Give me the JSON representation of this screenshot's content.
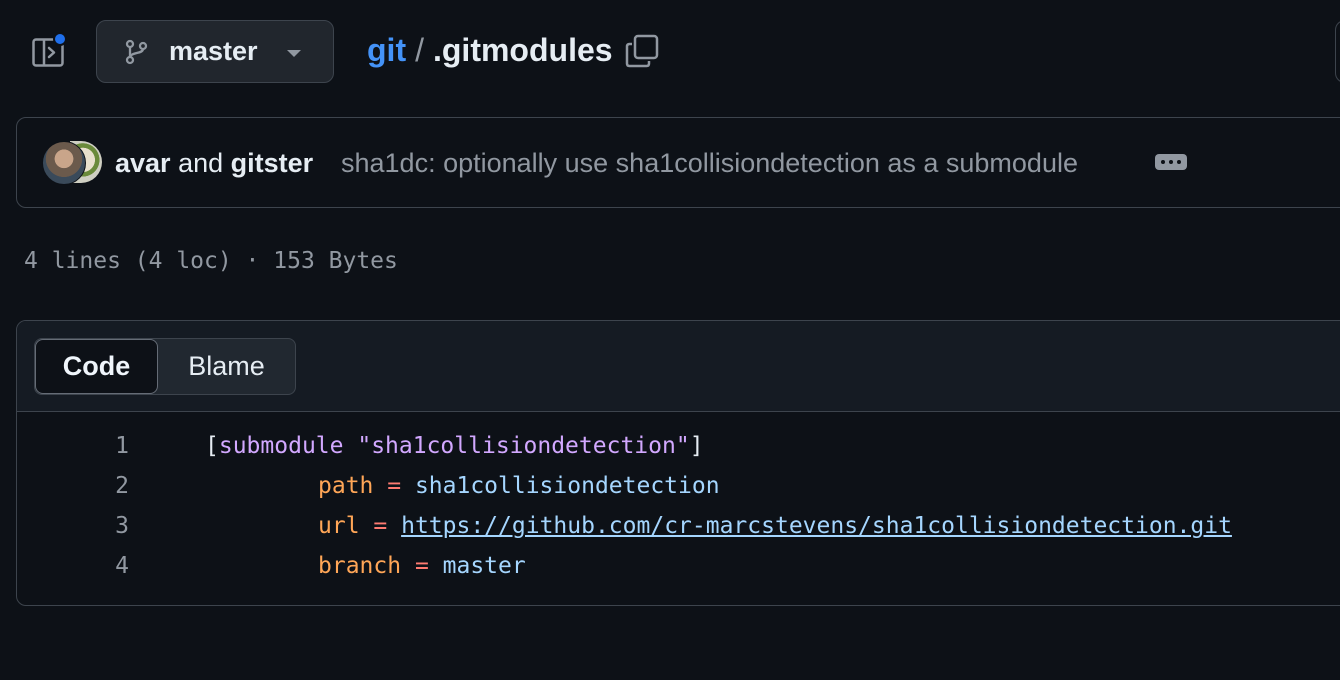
{
  "header": {
    "branch": "master",
    "repo": "git",
    "separator": "/",
    "file": ".gitmodules"
  },
  "commit": {
    "author1": "avar",
    "and": "and",
    "author2": "gitster",
    "message": "sha1dc: optionally use sha1collisiondetection as a submodule"
  },
  "file_meta": "4 lines (4 loc) · 153 Bytes",
  "tabs": {
    "code": "Code",
    "blame": "Blame"
  },
  "code": {
    "lines": [
      {
        "num": "1",
        "open": "[",
        "section": "submodule",
        "space": " ",
        "name": "\"sha1collisiondetection\"",
        "close": "]"
      },
      {
        "num": "2",
        "key": "path",
        "eq": " = ",
        "value": "sha1collisiondetection"
      },
      {
        "num": "3",
        "key": "url",
        "eq": " = ",
        "value": "https://github.com/cr-marcstevens/sha1collisiondetection.git"
      },
      {
        "num": "4",
        "key": "branch",
        "eq": " = ",
        "value": "master"
      }
    ]
  },
  "icons": {
    "sidebar": "sidebar-expand-icon",
    "branch": "git-branch-icon",
    "copy": "copy-icon",
    "more": "kebab-horizontal-icon"
  },
  "colors": {
    "background": "#0d1117",
    "accent": "#4493f8",
    "muted": "#9198a1"
  }
}
